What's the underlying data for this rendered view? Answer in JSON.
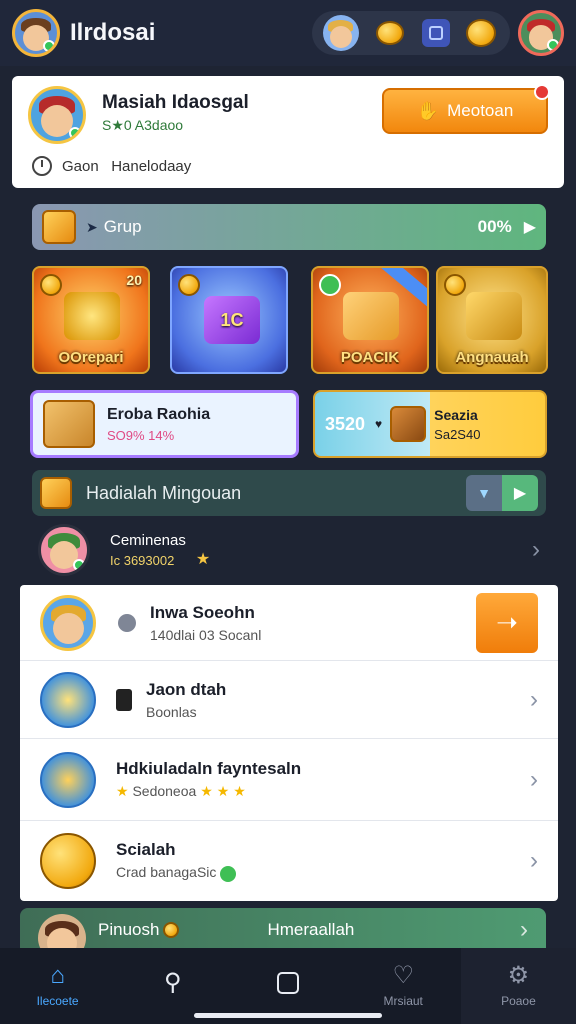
{
  "app": {
    "title": "Ilrdosai"
  },
  "colors": {
    "accent_orange": "#f2870d",
    "accent_green": "#57b87c",
    "nav_active": "#4aa8ff",
    "bg": "#1e2433"
  },
  "profile": {
    "name": "Masiah Idaosgal",
    "subtitle": "S★0 A3daoo",
    "follow_label": "Meotoan",
    "meta": "Gaon   Hanelodaay"
  },
  "group": {
    "label": "Grup",
    "percent": "00%"
  },
  "tiles": [
    {
      "label": "OOrepari",
      "count": "20"
    },
    {
      "label": "1C",
      "count": ""
    },
    {
      "label": "POACIK",
      "count": ""
    },
    {
      "label": "Angnauah",
      "count": ""
    }
  ],
  "promos": [
    {
      "title": "Eroba Raohia",
      "sub": "SO9% 14%"
    },
    {
      "value": "3520",
      "title": "Seazia",
      "sub": "Sa2S40"
    }
  ],
  "weekly": {
    "label": "Hadialah Mingouan"
  },
  "featured": {
    "title": "Ceminenas",
    "sub": "Ic 3693002"
  },
  "list": [
    {
      "title": "Inwa Soeohn",
      "sub": "140dlai 03 Socanl"
    },
    {
      "title": "Jaon dtah",
      "sub": "Boonlas"
    },
    {
      "title": "Hdkiuladaln fayntesaln",
      "sub": "Sedoneoa"
    },
    {
      "title": "Scialah",
      "sub": "Crad banagaSic"
    }
  ],
  "bottom_promo": {
    "left": "Pinuosh",
    "right": "Hmeraallah"
  },
  "nav": [
    {
      "label": "Ilecoete",
      "icon": "home-icon"
    },
    {
      "label": "",
      "icon": "search-icon"
    },
    {
      "label": "",
      "icon": "square-icon"
    },
    {
      "label": "Mrsiaut",
      "icon": "heart-icon"
    },
    {
      "label": "Poaoe",
      "icon": "settings-icon"
    }
  ]
}
